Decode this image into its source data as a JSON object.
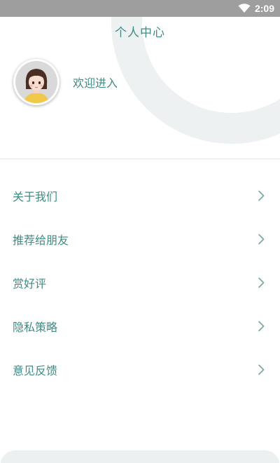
{
  "status_bar": {
    "time": "2:09",
    "wifi_icon": "wifi-icon"
  },
  "header": {
    "title": "个人中心",
    "welcome": "欢迎进入",
    "avatar_icon": "avatar-girl-icon",
    "ring_color": "#eef1f1"
  },
  "menu": {
    "items": [
      {
        "label": "关于我们",
        "icon": "chevron-right-icon"
      },
      {
        "label": "推荐给朋友",
        "icon": "chevron-right-icon"
      },
      {
        "label": "赏好评",
        "icon": "chevron-right-icon"
      },
      {
        "label": "隐私策略",
        "icon": "chevron-right-icon"
      },
      {
        "label": "意见反馈",
        "icon": "chevron-right-icon"
      }
    ]
  },
  "colors": {
    "accent": "#3f8c84",
    "status_bar": "#9e9e9e",
    "chevron": "#7aa6a1"
  }
}
